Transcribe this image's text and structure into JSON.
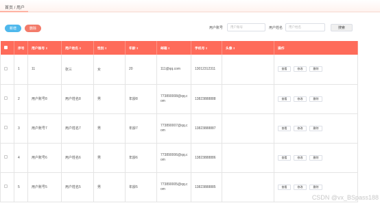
{
  "breadcrumb": "首页 / 用户",
  "toolbar": {
    "add_label": "新增",
    "delete_label": "删除"
  },
  "search": {
    "account_label": "用户账号",
    "account_placeholder": "用户账号",
    "name_label": "用户姓名",
    "name_placeholder": "用户姓名",
    "button_label": "搜索"
  },
  "table": {
    "columns": [
      "序号",
      "用户账号",
      "用户姓名",
      "性别",
      "年龄",
      "邮箱",
      "手机号",
      "头像",
      "操作"
    ],
    "sort_marker": "⇕",
    "action_labels": {
      "view": "查看",
      "edit": "修改",
      "delete": "删除"
    },
    "rows": [
      {
        "index": "1",
        "account": "11",
        "name": "张三",
        "gender": "女",
        "age": "20",
        "email": "111@qq.com",
        "phone": "13012312311"
      },
      {
        "index": "2",
        "account": "用户账号8",
        "name": "用户姓名8",
        "gender": "男",
        "age": "年龄8",
        "email": "773890008@qq.com",
        "phone": "13823888888"
      },
      {
        "index": "3",
        "account": "用户账号7",
        "name": "用户姓名7",
        "gender": "男",
        "age": "年龄7",
        "email": "773890007@qq.com",
        "phone": "13823888887"
      },
      {
        "index": "4",
        "account": "用户账号6",
        "name": "用户姓名6",
        "gender": "男",
        "age": "年龄6",
        "email": "773890006@qq.com",
        "phone": "13823888886"
      },
      {
        "index": "5",
        "account": "用户账号5",
        "name": "用户姓名5",
        "gender": "男",
        "age": "年龄5",
        "email": "773890005@qq.com",
        "phone": "13823888885"
      }
    ]
  },
  "watermark": "CSDN @vx_BSpass188"
}
